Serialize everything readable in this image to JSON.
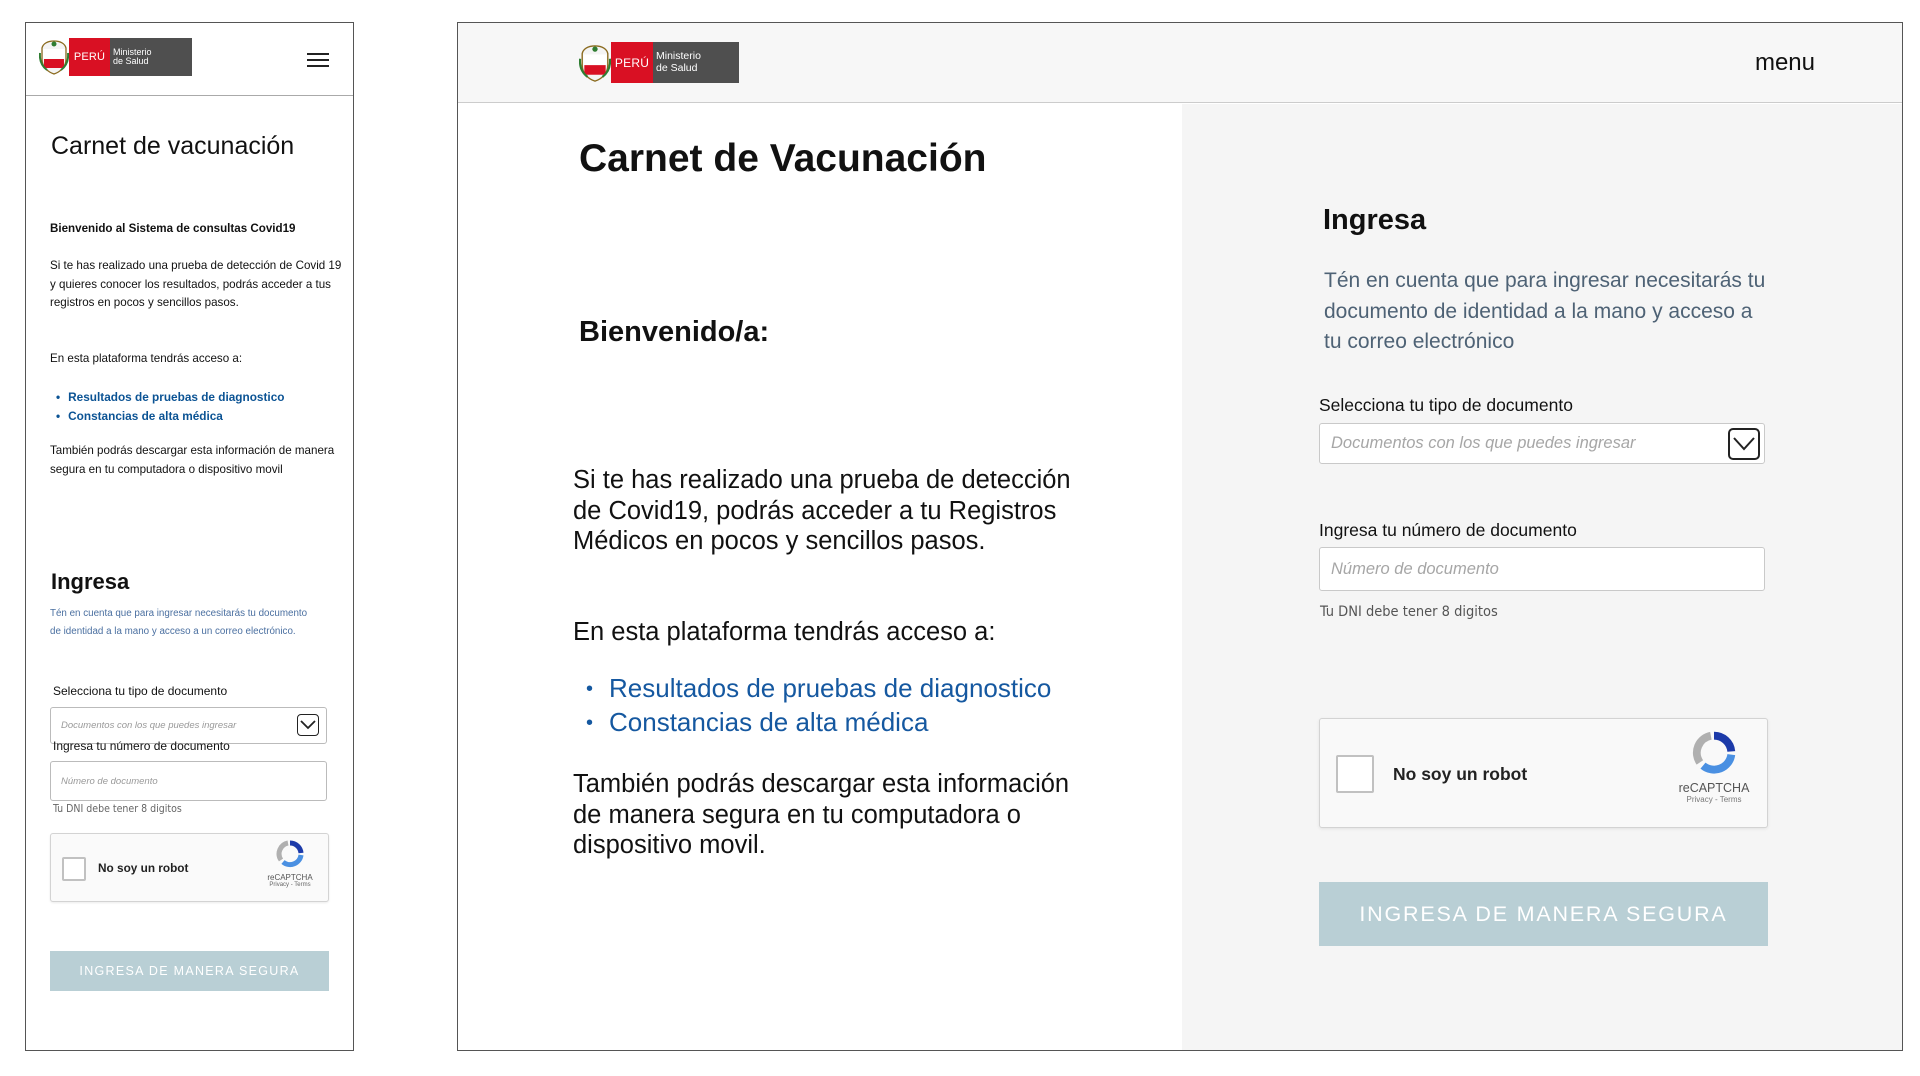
{
  "brand": {
    "country": "PERÚ",
    "ministry_line1": "Ministerio",
    "ministry_line2": "de Salud",
    "colors": {
      "red": "#d91023",
      "gray": "#4f4f4f"
    }
  },
  "mobile": {
    "title": "Carnet de vacunación",
    "welcome": "Bienvenido al Sistema de consultas Covid19",
    "intro": "Si te has realizado una prueba de detección de Covid 19 y quieres conocer los resultados, podrás acceder a tus registros en pocos y sencillos pasos.",
    "access_intro": "En esta plataforma tendrás acceso a:",
    "access_items": [
      "Resultados de pruebas de diagnostico",
      "Constancias de alta médica"
    ],
    "download": "También podrás descargar esta información de manera segura en tu computadora o dispositivo movil",
    "login": {
      "heading": "Ingresa",
      "hint": "Tén en cuenta que para ingresar necesitarás tu documento de identidad a la mano y acceso a un correo electrónico.",
      "doc_type_label": "Selecciona tu tipo de documento",
      "doc_type_placeholder": "Documentos con los que puedes ingresar",
      "doc_number_label": "Ingresa tu número de documento",
      "doc_number_placeholder": "Número de documento",
      "dni_note": "Tu DNI debe tener 8 digitos",
      "captcha_label": "No soy un robot",
      "captcha_brand": "reCAPTCHA",
      "captcha_links": "Privacy - Terms",
      "submit": "INGRESA DE MANERA SEGURA"
    }
  },
  "desktop": {
    "menu": "menu",
    "title": "Carnet de Vacunación",
    "welcome": "Bienvenido/a:",
    "intro": "Si te has realizado una prueba de detección de Covid19, podrás acceder a tu Registros Médicos en pocos y sencillos pasos.",
    "access_intro": "En esta plataforma tendrás acceso a:",
    "access_items": [
      "Resultados de pruebas de diagnostico",
      "Constancias de alta médica"
    ],
    "download": "También podrás descargar esta información de manera segura en tu computadora o dispositivo movil.",
    "login": {
      "heading": "Ingresa",
      "hint": "Tén en cuenta que para ingresar necesitarás tu documento de identidad a la mano y acceso a tu correo electrónico",
      "doc_type_label": "Selecciona tu tipo de documento",
      "doc_type_placeholder": "Documentos con los que puedes ingresar",
      "doc_number_label": "Ingresa tu número de documento",
      "doc_number_placeholder": "Número de documento",
      "dni_note": "Tu DNI debe tener 8 digitos",
      "captcha_label": "No soy un robot",
      "captcha_brand": "reCAPTCHA",
      "captcha_links": "Privacy - Terms",
      "submit": "INGRESA DE MANERA SEGURA"
    }
  },
  "colors": {
    "link": "#1558a0",
    "button_disabled": "#b9cfd5",
    "hint": "#4e6275"
  },
  "icons": {
    "menu": "hamburger-icon",
    "select": "chevron-down-icon",
    "captcha": "recaptcha-icon"
  }
}
